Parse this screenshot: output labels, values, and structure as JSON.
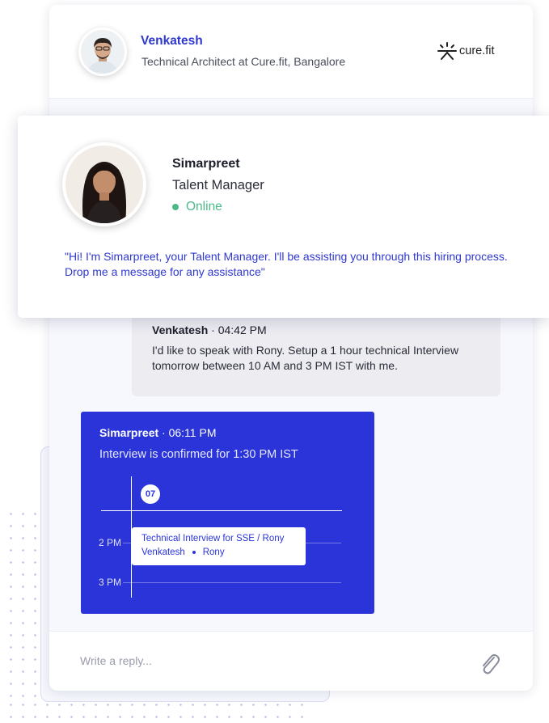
{
  "header": {
    "name": "Venkatesh",
    "role": "Technical Architect at Cure.fit, Bangalore",
    "brand": "cure.fit"
  },
  "talent_manager": {
    "name": "Simarpreet",
    "role": "Talent Manager",
    "status": "Online",
    "quote": "\"Hi! I'm Simarpreet, your Talent Manager. I'll be assisting you through this hiring process. Drop me a message for any assistance\""
  },
  "messages": [
    {
      "sender": "Venkatesh",
      "time": " · 04:42 PM",
      "text": "I'd like to speak with Rony. Setup a 1 hour technical Interview tomorrow between 10 AM and 3 PM IST with me."
    },
    {
      "sender": "Simarpreet",
      "time": " · 06:11 PM",
      "text": "Interview is confirmed for 1:30 PM IST"
    }
  ],
  "calendar": {
    "day": "07",
    "time_labels": [
      "2 PM",
      "3 PM"
    ],
    "event_title": "Technical Interview for SSE / Rony",
    "participants": [
      "Venkatesh",
      "Rony"
    ]
  },
  "reply": {
    "placeholder": "Write a reply..."
  },
  "colors": {
    "accent": "#2a34d9",
    "online": "#4cb98b"
  }
}
